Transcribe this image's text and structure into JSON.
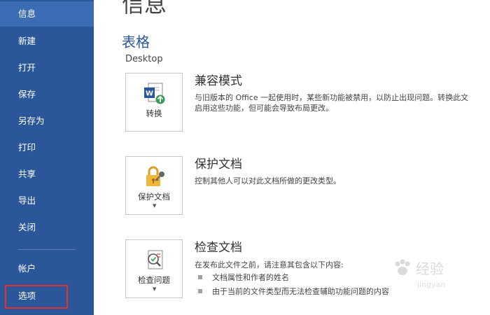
{
  "sidebar": {
    "items": [
      {
        "label": "信息",
        "active": true
      },
      {
        "label": "新建"
      },
      {
        "label": "打开"
      },
      {
        "label": "保存"
      },
      {
        "label": "另存为"
      },
      {
        "label": "打印"
      },
      {
        "label": "共享"
      },
      {
        "label": "导出"
      },
      {
        "label": "关闭"
      },
      {
        "label": "帐户"
      },
      {
        "label": "选项"
      }
    ]
  },
  "main": {
    "title": "信息",
    "doc_name": "表格",
    "doc_path": "Desktop",
    "sections": [
      {
        "button_label": "转换",
        "icon": "word-convert-icon",
        "title": "兼容模式",
        "desc_line1": "与旧版本的 Office 一起使用时，某些新功能被禁用，以防止出现问题。转换此文",
        "desc_line2": "启用这些功能，但可能会导致布局更改。"
      },
      {
        "button_label": "保护文档",
        "icon": "lock-key-icon",
        "title": "保护文档",
        "desc_line1": "控制其他人可以对此文档所做的更改类型。"
      },
      {
        "button_label": "检查问题",
        "icon": "inspect-document-icon",
        "title": "检查文档",
        "desc_line1": "在发布此文件之前，请注意其包含以下内容:",
        "bullets": [
          "文档属性和作者的姓名",
          "由于当前的文件类型而无法检查辅助功能问题的内容"
        ]
      }
    ]
  },
  "watermark": {
    "text": "经验",
    "sub": "jingyan"
  },
  "colors": {
    "sidebar": "#2b579a",
    "active": "#3c6cb4",
    "accent": "#2b579a",
    "highlight": "#e23030"
  }
}
